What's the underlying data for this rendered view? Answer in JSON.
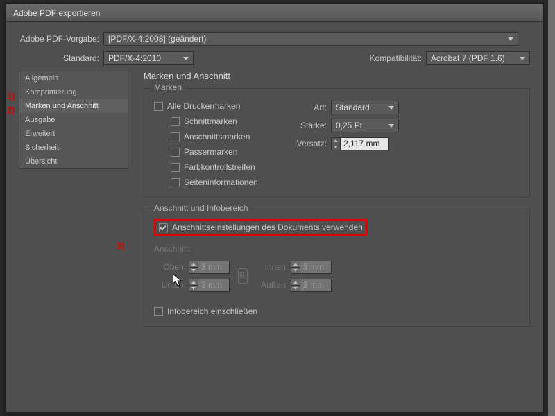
{
  "title": "Adobe PDF exportieren",
  "labels": {
    "preset": "Adobe PDF-Vorgabe:",
    "standard": "Standard:",
    "compat": "Kompatibilität:"
  },
  "dropdowns": {
    "preset": "[PDF/X-4:2008] (geändert)",
    "standard": "PDF/X-4:2010",
    "compat": "Acrobat 7 (PDF 1.6)"
  },
  "sidebar": {
    "items": [
      "Allgemein",
      "Komprimierung",
      "Marken und Anschnitt",
      "Ausgabe",
      "Erweitert",
      "Sicherheit",
      "Übersicht"
    ],
    "selectedIndex": 2
  },
  "panel": {
    "heading": "Marken und Anschnitt",
    "marks": {
      "caption": "Marken",
      "all": "Alle Druckermarken",
      "items": [
        "Schnittmarken",
        "Anschnittsmarken",
        "Passermarken",
        "Farbkontrollstreifen",
        "Seiteninformationen"
      ],
      "art_lbl": "Art:",
      "art_val": "Standard",
      "weight_lbl": "Stärke:",
      "weight_val": "0,25 Pt",
      "offset_lbl": "Versatz:",
      "offset_val": "2,117 mm"
    },
    "bleed": {
      "caption": "Anschnitt und Infobereich",
      "usedoc": "Anschnittseinstellungen des Dokuments verwenden",
      "heading": "Anschnitt:",
      "top": "Oben:",
      "bottom": "Unten:",
      "inner": "Innen:",
      "outer": "Außen:",
      "val": "3 mm",
      "slug": "Infobereich einschließen"
    }
  },
  "annotations": {
    "a1": "1)",
    "a2": "2)",
    "a3": "3)"
  }
}
